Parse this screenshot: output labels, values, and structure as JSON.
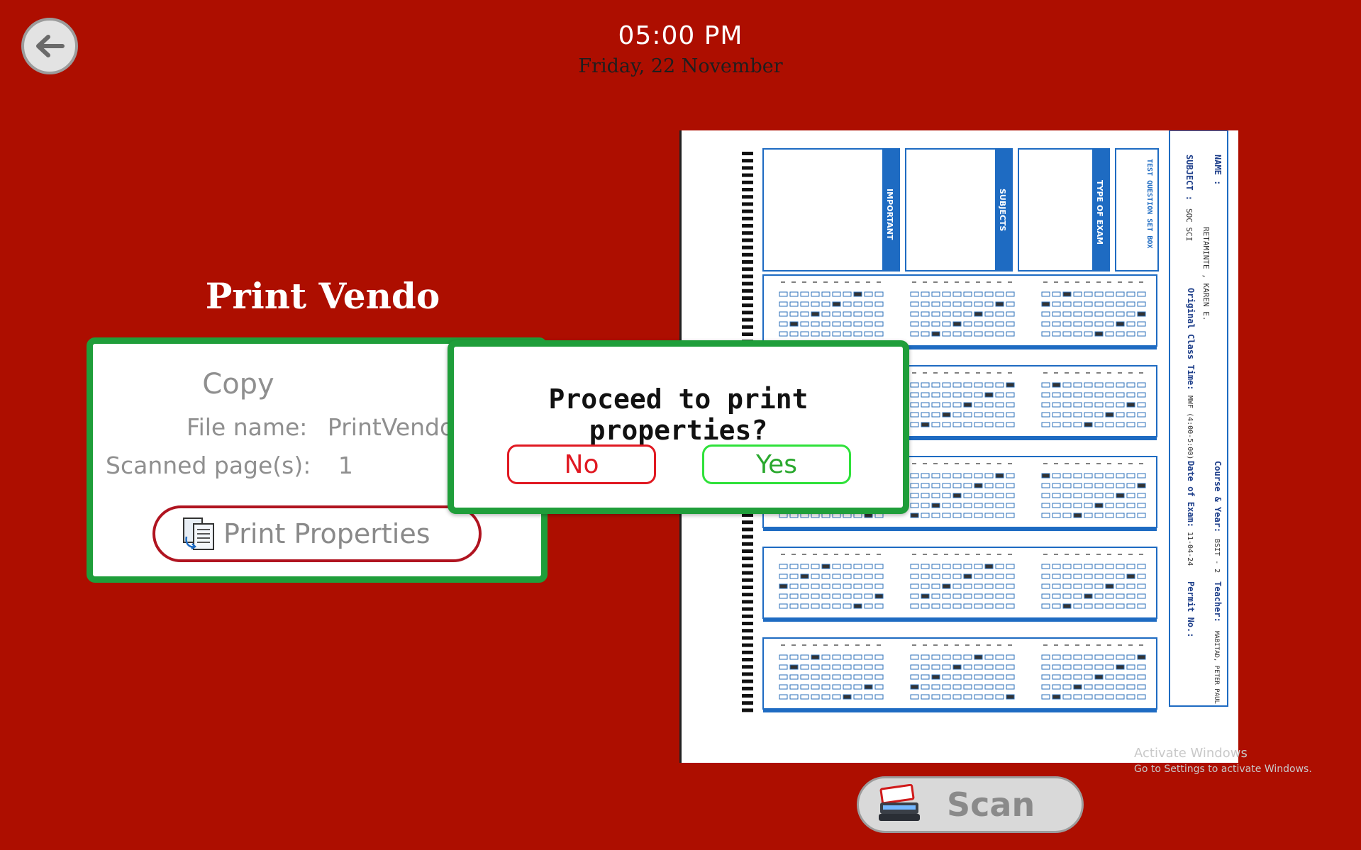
{
  "clock": {
    "time": "05:00 PM",
    "date": "Friday, 22 November"
  },
  "app_title": "Print Vendo",
  "card": {
    "title": "Copy",
    "file_label": "File name:",
    "file_value": "PrintVendo.p",
    "pages_label": "Scanned page(s):",
    "pages_value": "1",
    "print_properties_label": "Print Properties"
  },
  "dialog": {
    "question": "Proceed to print properties?",
    "no_label": "No",
    "yes_label": "Yes"
  },
  "scan_label": "Scan",
  "sheet": {
    "name_label": "NAME :",
    "name_value": "RETAMINTE , KAREN E.",
    "subject_label": "SUBJECT :",
    "subject_value": "SOC SCI",
    "class_time_label": "Original Class Time:",
    "class_time_value": "MWF (4:00-5:00)",
    "course_label": "Course & Year:",
    "course_value": "BSIT - 2",
    "date_label": "Date of Exam:",
    "date_value": "11-04-24",
    "teacher_label": "Teacher:",
    "teacher_value": "MABITAD, PETER PAUL",
    "permit_label": "Permit No.:",
    "box_set": "TEST QUESTION SET BOX",
    "box_exam": "TYPE OF EXAM",
    "box_subjects": "SUBJECTS",
    "box_important": "IMPORTANT"
  },
  "watermark": {
    "line1": "Activate Windows",
    "line2": "Go to Settings to activate Windows."
  },
  "colors": {
    "background": "#ad0e00",
    "card_border": "#1f9e3a",
    "no": "#e01922",
    "yes": "#2fe13a",
    "sheet_blue": "#1e6bc2"
  }
}
